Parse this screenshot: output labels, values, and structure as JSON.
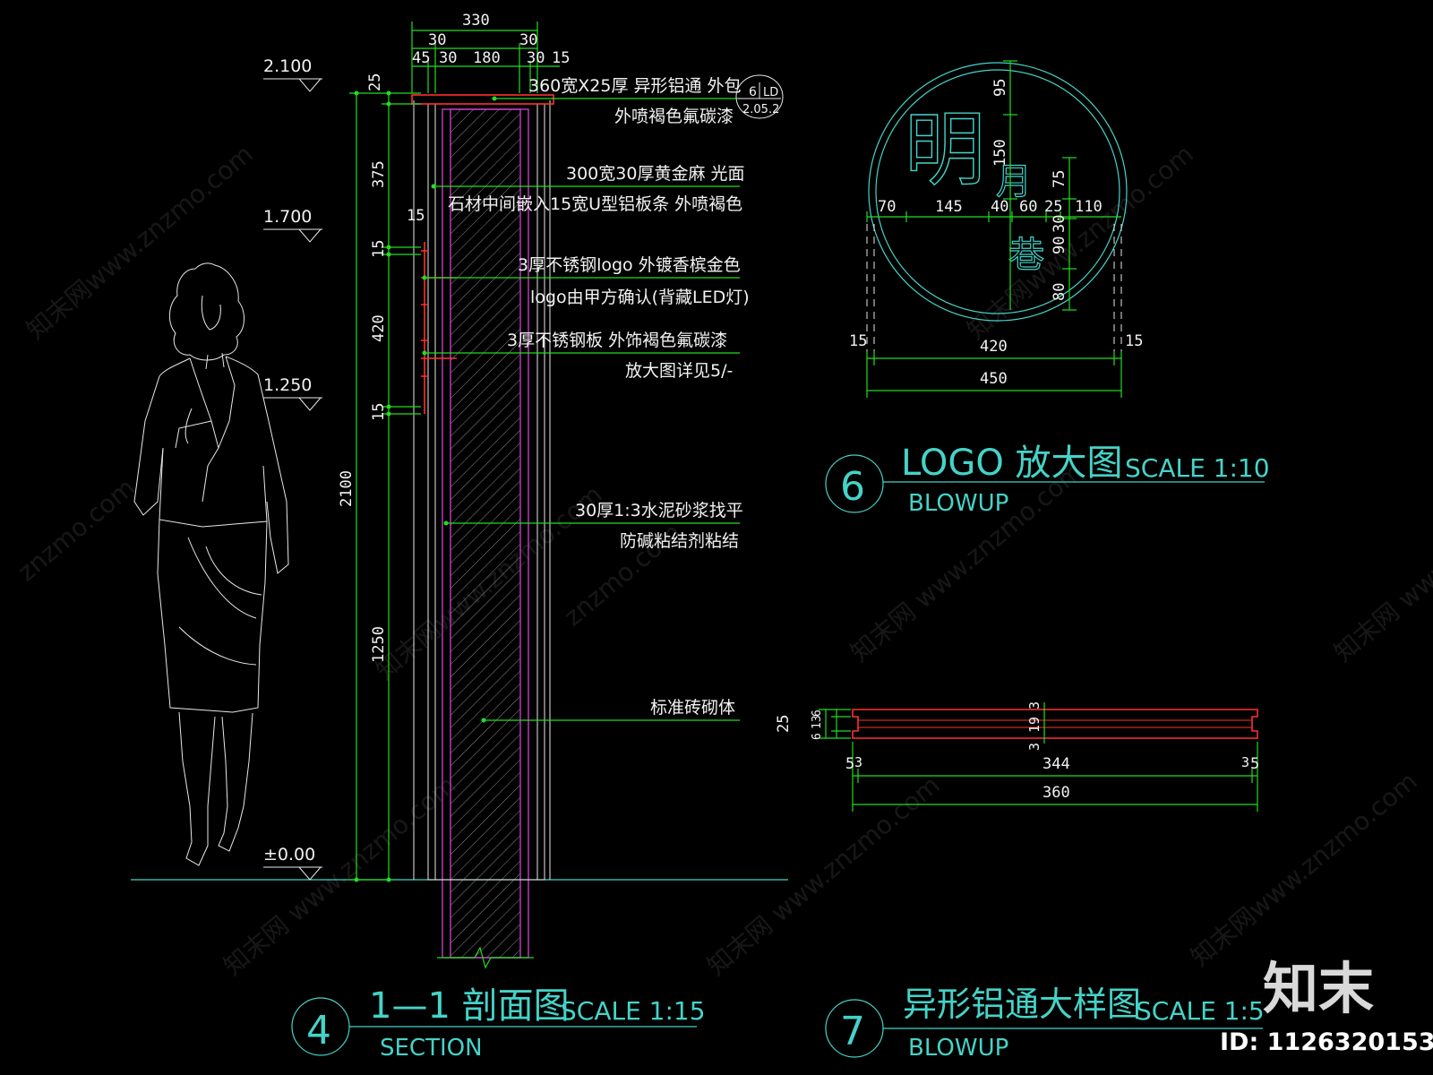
{
  "watermark": {
    "texts": [
      "知末网www.znzmo.com",
      "znzmo.com",
      "知末网 www.znzmo.com"
    ],
    "logo": "知末",
    "id_label": "ID: 1126320153"
  },
  "section_view": {
    "dims_top": {
      "total": "330",
      "a": "30",
      "b": "30",
      "c": "45",
      "d": "30",
      "e": "180",
      "f": "30",
      "g": "15"
    },
    "dims_left": {
      "d1": "25",
      "d2": "375",
      "d3": "15",
      "d4": "420",
      "d5": "15",
      "d6": "1250",
      "total": "2100",
      "small": "15"
    },
    "levels": [
      "2.100",
      "1.700",
      "1.250",
      "±0.00"
    ],
    "notes": [
      "360宽X25厚 异形铝通 外包",
      "外喷褐色氟碳漆",
      "300宽30厚黄金麻 光面",
      "石材中间嵌入15宽U型铝板条 外喷褐色",
      "3厚不锈钢logo 外镀香槟金色",
      "logo由甲方确认(背藏LED灯)",
      "3厚不锈钢板  外饰褐色氟碳漆",
      "放大图详见5/-",
      "30厚1:3水泥砂浆找平",
      "防碱粘结剂粘结",
      "标准砖砌体"
    ],
    "ref_tag": {
      "top_left": "6",
      "top_right": "LD",
      "bottom": "2.05.2"
    },
    "title": {
      "num": "4",
      "name": "1—1 剖面图",
      "scale": "SCALE 1:15",
      "sub": "SECTION"
    }
  },
  "logo_view": {
    "chars": [
      "明",
      "月",
      "巷"
    ],
    "dims_h": [
      "70",
      "145",
      "40",
      "60",
      "25",
      "110"
    ],
    "dims_v": [
      "95",
      "150",
      "75",
      "90",
      "30",
      "80"
    ],
    "side": [
      "15",
      "15"
    ],
    "inner": "420",
    "outer": "450",
    "title": {
      "num": "6",
      "name": "LOGO 放大图",
      "scale": "SCALE 1:10",
      "sub": "BLOWUP"
    }
  },
  "profile_view": {
    "dims_left": [
      "25",
      "6",
      "13",
      "6"
    ],
    "dims_mid": [
      "3",
      "19",
      "3"
    ],
    "dims_bottom": [
      "5",
      "3",
      "344",
      "3",
      "5"
    ],
    "total": "360",
    "title": {
      "num": "7",
      "name": "异形铝通大样图",
      "scale": "SCALE 1:5",
      "sub": "BLOWUP"
    }
  },
  "colors": {
    "dim": "#22dd22",
    "title": "#45d3c8",
    "outline": "#e8e8e8",
    "red": "#ff3030",
    "magenta": "#c040c0"
  }
}
